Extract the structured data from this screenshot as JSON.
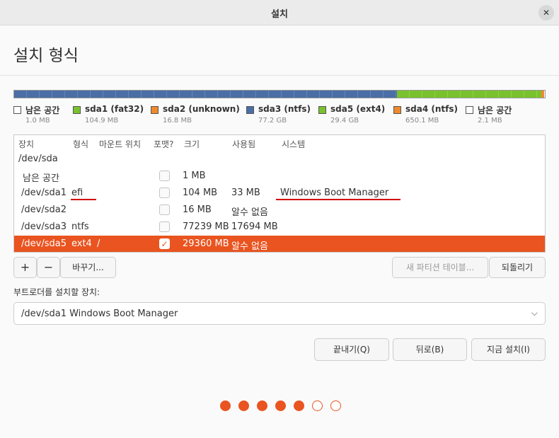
{
  "window": {
    "title": "설치",
    "close_glyph": "✕"
  },
  "page": {
    "heading": "설치 형식"
  },
  "legend": [
    {
      "name": "남은 공간",
      "size": "1.0 MB",
      "color": "#ffffff"
    },
    {
      "name": "sda1 (fat32)",
      "size": "104.9 MB",
      "color": "#79c22d"
    },
    {
      "name": "sda2 (unknown)",
      "size": "16.8 MB",
      "color": "#ef8a2c"
    },
    {
      "name": "sda3 (ntfs)",
      "size": "77.2 GB",
      "color": "#4a6ea5"
    },
    {
      "name": "sda5 (ext4)",
      "size": "29.4 GB",
      "color": "#79c22d"
    },
    {
      "name": "sda4 (ntfs)",
      "size": "650.1 MB",
      "color": "#ef8a2c"
    },
    {
      "name": "남은 공간",
      "size": "2.1 MB",
      "color": "#ffffff"
    }
  ],
  "table": {
    "headers": {
      "device": "장치",
      "type": "형식",
      "mount": "마운트 위치",
      "format": "포맷?",
      "size": "크기",
      "used": "사용됨",
      "system": "시스템"
    },
    "rows": [
      {
        "device": "/dev/sda",
        "type": "",
        "mount": "",
        "format": null,
        "size": "",
        "used": "",
        "system": ""
      },
      {
        "device": "남은 공간",
        "type": "",
        "mount": "",
        "format": false,
        "size": "1 MB",
        "used": "",
        "system": ""
      },
      {
        "device": "/dev/sda1",
        "type": "efi",
        "mount": "",
        "format": false,
        "size": "104 MB",
        "used": "33 MB",
        "system": "Windows Boot Manager"
      },
      {
        "device": "/dev/sda2",
        "type": "",
        "mount": "",
        "format": false,
        "size": "16 MB",
        "used": "알수 없음",
        "system": ""
      },
      {
        "device": "/dev/sda3",
        "type": "ntfs",
        "mount": "",
        "format": false,
        "size": "77239 MB",
        "used": "17694 MB",
        "system": ""
      },
      {
        "device": "/dev/sda5",
        "type": "ext4",
        "mount": "/",
        "format": true,
        "size": "29360 MB",
        "used": "알수 없음",
        "system": "",
        "selected": true
      }
    ]
  },
  "actions": {
    "add": "+",
    "remove": "−",
    "change": "바꾸기...",
    "new_table": "새 파티션 테이블...",
    "revert": "되돌리기"
  },
  "bootloader": {
    "label": "부트로더를 설치할 장치:",
    "value": "/dev/sda1 Windows Boot Manager",
    "arrow": "⌵"
  },
  "footer": {
    "quit": "끝내기(Q)",
    "back": "뒤로(B)",
    "install": "지금 설치(I)"
  },
  "progress": {
    "completed_steps": 5,
    "total_steps": 7
  },
  "colors": {
    "accent": "#e95420",
    "annotation_underline": "#d40000"
  }
}
